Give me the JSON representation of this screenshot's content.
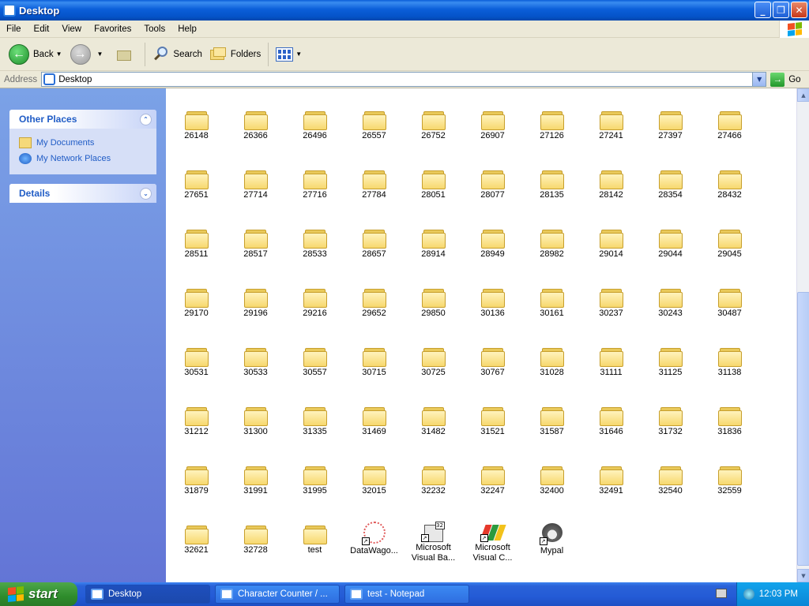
{
  "window": {
    "title": "Desktop"
  },
  "menubar": {
    "items": [
      "File",
      "Edit",
      "View",
      "Favorites",
      "Tools",
      "Help"
    ]
  },
  "toolbar": {
    "back_label": "Back",
    "search_label": "Search",
    "folders_label": "Folders"
  },
  "address": {
    "label": "Address",
    "value": "Desktop",
    "go_label": "Go"
  },
  "taskpane": {
    "other_places": {
      "title": "Other Places",
      "links": [
        "My Documents",
        "My Network Places"
      ]
    },
    "details": {
      "title": "Details"
    }
  },
  "files": [
    "26148",
    "26366",
    "26496",
    "26557",
    "26752",
    "26907",
    "27126",
    "27241",
    "27397",
    "27466",
    "27651",
    "27714",
    "27716",
    "27784",
    "28051",
    "28077",
    "28135",
    "28142",
    "28354",
    "28432",
    "28511",
    "28517",
    "28533",
    "28657",
    "28914",
    "28949",
    "28982",
    "29014",
    "29044",
    "29045",
    "29170",
    "29196",
    "29216",
    "29652",
    "29850",
    "30136",
    "30161",
    "30237",
    "30243",
    "30487",
    "30531",
    "30533",
    "30557",
    "30715",
    "30725",
    "30767",
    "31028",
    "31111",
    "31125",
    "31138",
    "31212",
    "31300",
    "31335",
    "31469",
    "31482",
    "31521",
    "31587",
    "31646",
    "31732",
    "31836",
    "31879",
    "31991",
    "31995",
    "32015",
    "32232",
    "32247",
    "32400",
    "32491",
    "32540",
    "32559",
    "32621",
    "32728",
    "test"
  ],
  "shortcuts": [
    {
      "label": "DataWago...",
      "icon": "datawago-icon"
    },
    {
      "label": "Microsoft Visual Ba...",
      "icon": "visual-basic-icon"
    },
    {
      "label": "Microsoft Visual C...",
      "icon": "visual-cpp-icon"
    },
    {
      "label": "Mypal",
      "icon": "mypal-icon"
    }
  ],
  "taskbar": {
    "start_label": "start",
    "tasks": [
      "Desktop",
      "Character Counter / ...",
      "test - Notepad"
    ],
    "clock": "12:03 PM"
  }
}
